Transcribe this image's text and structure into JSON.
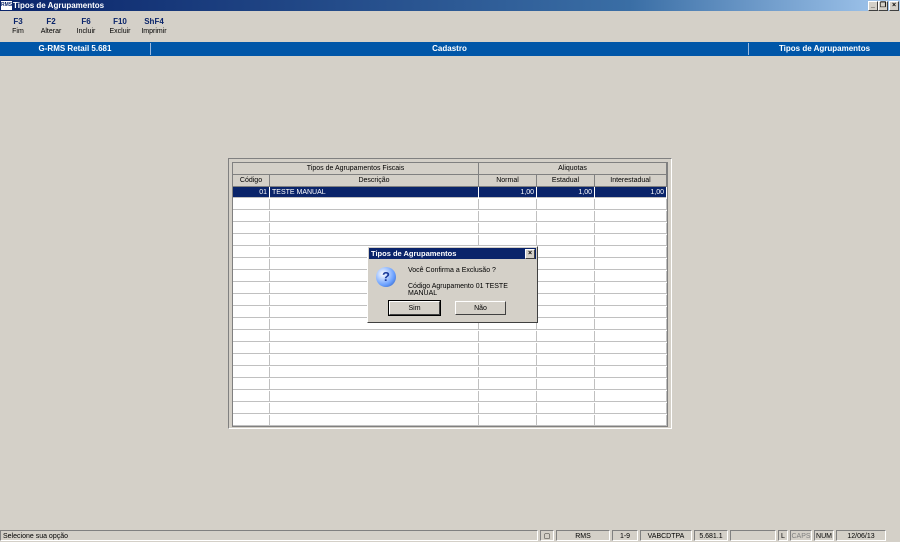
{
  "window": {
    "title": "Tipos de Agrupamentos",
    "app_icon_text": "RMS"
  },
  "toolbar": [
    {
      "key": "F3",
      "label": "Fim"
    },
    {
      "key": "F2",
      "label": "Alterar"
    },
    {
      "key": "F6",
      "label": "Incluir"
    },
    {
      "key": "F10",
      "label": "Excluir"
    },
    {
      "key": "ShF4",
      "label": "Imprimir"
    }
  ],
  "infobar": {
    "system": "G-RMS Retail 5.681",
    "module": "Cadastro",
    "screen": "Tipos de Agrupamentos"
  },
  "grid": {
    "group_headers": [
      "Tipos de Agrupamentos Fiscais",
      "Aliquotas"
    ],
    "columns": [
      "Código",
      "Descrição",
      "Normal",
      "Estadual",
      "Interestadual"
    ],
    "rows": [
      {
        "codigo": "01",
        "descricao": "TESTE MANUAL",
        "normal": "1,00",
        "estadual": "1,00",
        "interestadual": "1,00"
      }
    ]
  },
  "dialog": {
    "title": "Tipos de Agrupamentos",
    "message": "Você Confirma a Exclusão ?",
    "detail": "Código Agrupamento  01  TESTE MANUAL",
    "yes": "Sim",
    "no": "Não"
  },
  "status": {
    "message": "Selecione sua opção",
    "user": "RMS",
    "page": "1-9",
    "program": "VABCDTPA",
    "version": "5.681.1",
    "l": "L",
    "caps": "CAPS",
    "num": "NUM",
    "date": "12/06/13"
  }
}
